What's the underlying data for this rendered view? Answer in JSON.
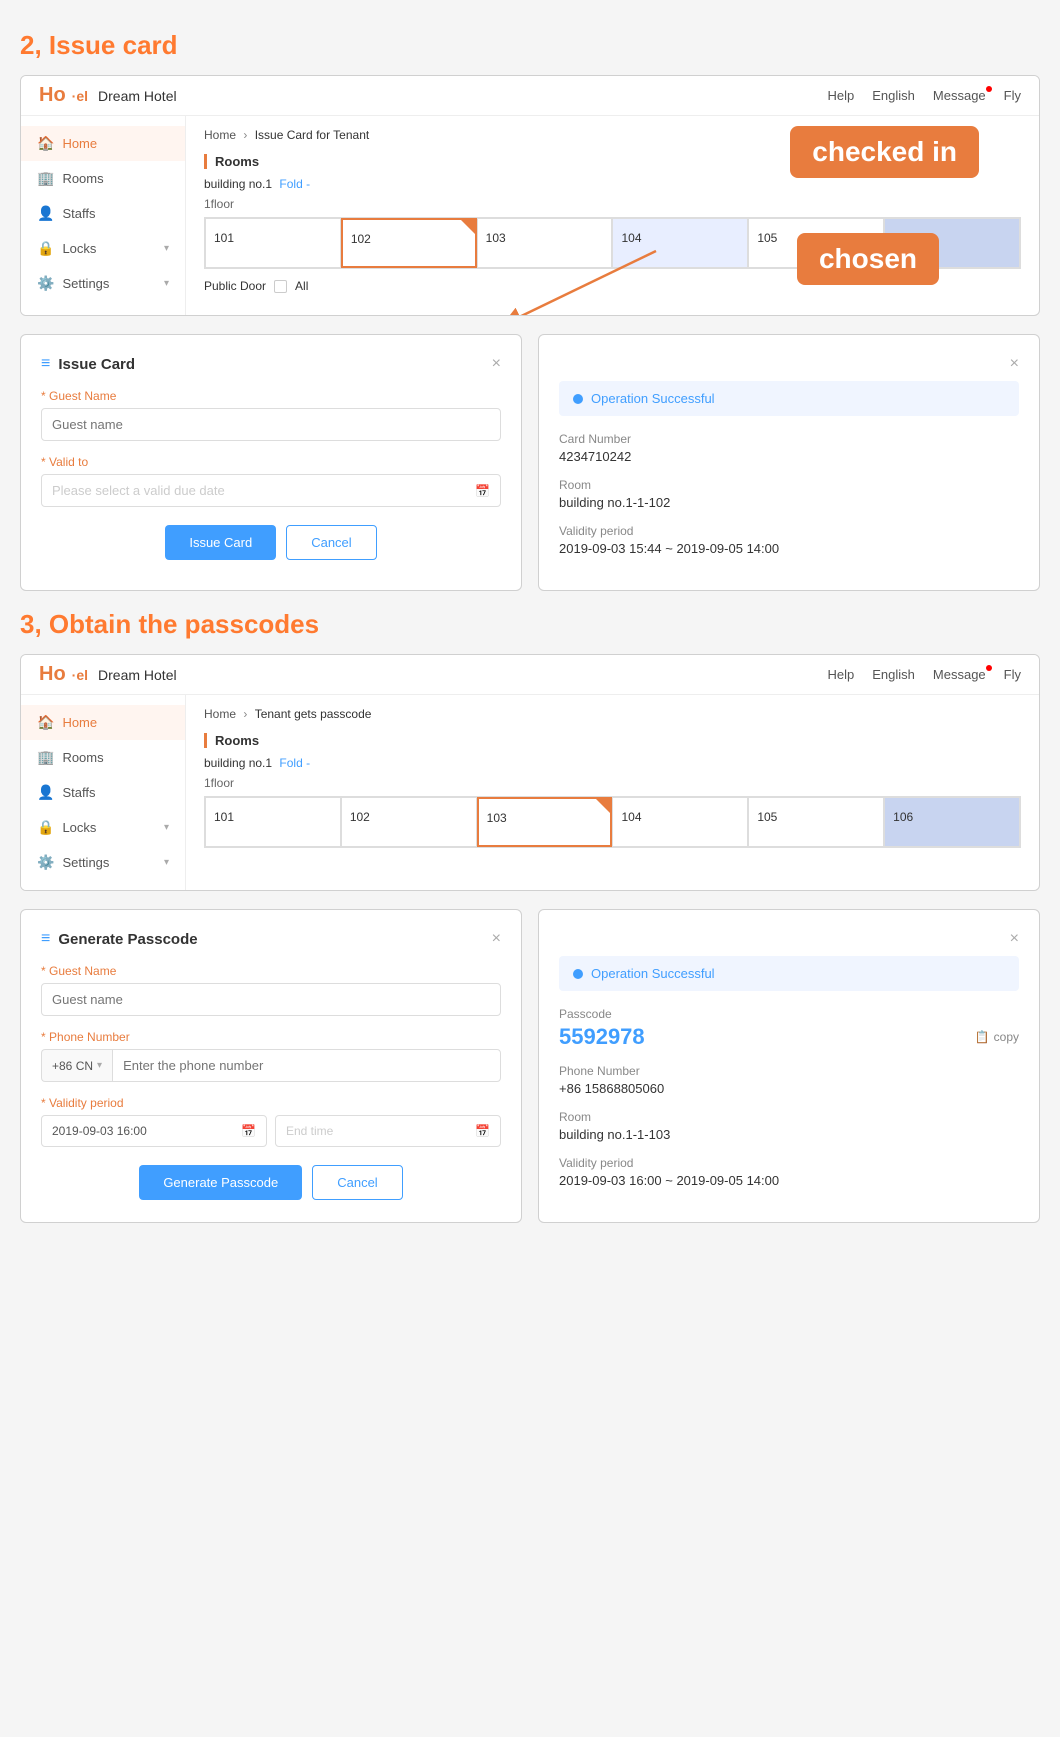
{
  "section2": {
    "title": "2, Issue card",
    "browser1": {
      "logo": "Ho'el",
      "hotel_name": "Dream Hotel",
      "nav": [
        "Help",
        "English",
        "Message",
        "Fly"
      ],
      "breadcrumb": [
        "Home",
        "Issue Card for Tenant"
      ],
      "sidebar": [
        {
          "label": "Home",
          "icon": "🏠",
          "active": true
        },
        {
          "label": "Rooms",
          "icon": "🏢",
          "active": false
        },
        {
          "label": "Staffs",
          "icon": "👤",
          "active": false
        },
        {
          "label": "Locks",
          "icon": "🔒",
          "active": false,
          "expandable": true
        },
        {
          "label": "Settings",
          "icon": "⚙️",
          "active": false,
          "expandable": true
        }
      ],
      "rooms_label": "Rooms",
      "building": "building no.1",
      "fold": "Fold -",
      "floor": "1floor",
      "rooms": [
        "101",
        "102",
        "103",
        "104",
        "105",
        "106"
      ],
      "room_states": [
        "normal",
        "selected",
        "normal",
        "checked",
        "normal",
        "checked-dark"
      ],
      "public_door": "Public Door",
      "all": "All"
    },
    "bubble_checked_in": "checked in",
    "bubble_chosen": "chosen",
    "dialog_issue": {
      "title": "Issue Card",
      "close": "×",
      "guest_name_label": "Guest Name",
      "guest_name_placeholder": "Guest name",
      "valid_to_label": "Valid to",
      "valid_to_placeholder": "Please select a valid due date",
      "btn_issue": "Issue Card",
      "btn_cancel": "Cancel"
    },
    "dialog_success1": {
      "close": "×",
      "operation": "Operation Successful",
      "card_number_label": "Card Number",
      "card_number": "4234710242",
      "room_label": "Room",
      "room": "building no.1-1-102",
      "validity_label": "Validity period",
      "validity": "2019-09-03 15:44  ~  2019-09-05 14:00"
    }
  },
  "section3": {
    "title": "3, Obtain the passcodes",
    "browser2": {
      "logo": "Ho'el",
      "hotel_name": "Dream Hotel",
      "nav": [
        "Help",
        "English",
        "Message",
        "Fly"
      ],
      "breadcrumb": [
        "Home",
        "Tenant gets passcode"
      ],
      "sidebar": [
        {
          "label": "Home",
          "icon": "🏠",
          "active": true
        },
        {
          "label": "Rooms",
          "icon": "🏢",
          "active": false
        },
        {
          "label": "Staffs",
          "icon": "👤",
          "active": false
        },
        {
          "label": "Locks",
          "icon": "🔒",
          "active": false,
          "expandable": true
        },
        {
          "label": "Settings",
          "icon": "⚙️",
          "active": false,
          "expandable": true
        }
      ],
      "rooms_label": "Rooms",
      "building": "building no.1",
      "fold": "Fold -",
      "floor": "1floor",
      "rooms": [
        "101",
        "102",
        "103",
        "104",
        "105",
        "106"
      ],
      "room_states": [
        "normal",
        "normal",
        "selected-orange",
        "normal",
        "normal",
        "checked-dark"
      ],
      "public_door": "Public Door",
      "all": "All"
    },
    "dialog_generate": {
      "title": "Generate Passcode",
      "close": "×",
      "guest_name_label": "Guest Name",
      "guest_name_placeholder": "Guest name",
      "phone_label": "Phone Number",
      "phone_prefix": "+86 CN",
      "phone_placeholder": "Enter the phone number",
      "validity_label": "Validity period",
      "start_time": "2019-09-03 16:00",
      "end_time_placeholder": "End time",
      "btn_generate": "Generate Passcode",
      "btn_cancel": "Cancel"
    },
    "dialog_success2": {
      "close": "×",
      "operation": "Operation Successful",
      "passcode_label": "Passcode",
      "passcode": "5592978",
      "copy_label": "copy",
      "phone_label": "Phone Number",
      "phone": "+86 15868805060",
      "room_label": "Room",
      "room": "building no.1-1-103",
      "validity_label": "Validity period",
      "validity": "2019-09-03 16:00  ~  2019-09-05 14:00"
    }
  }
}
